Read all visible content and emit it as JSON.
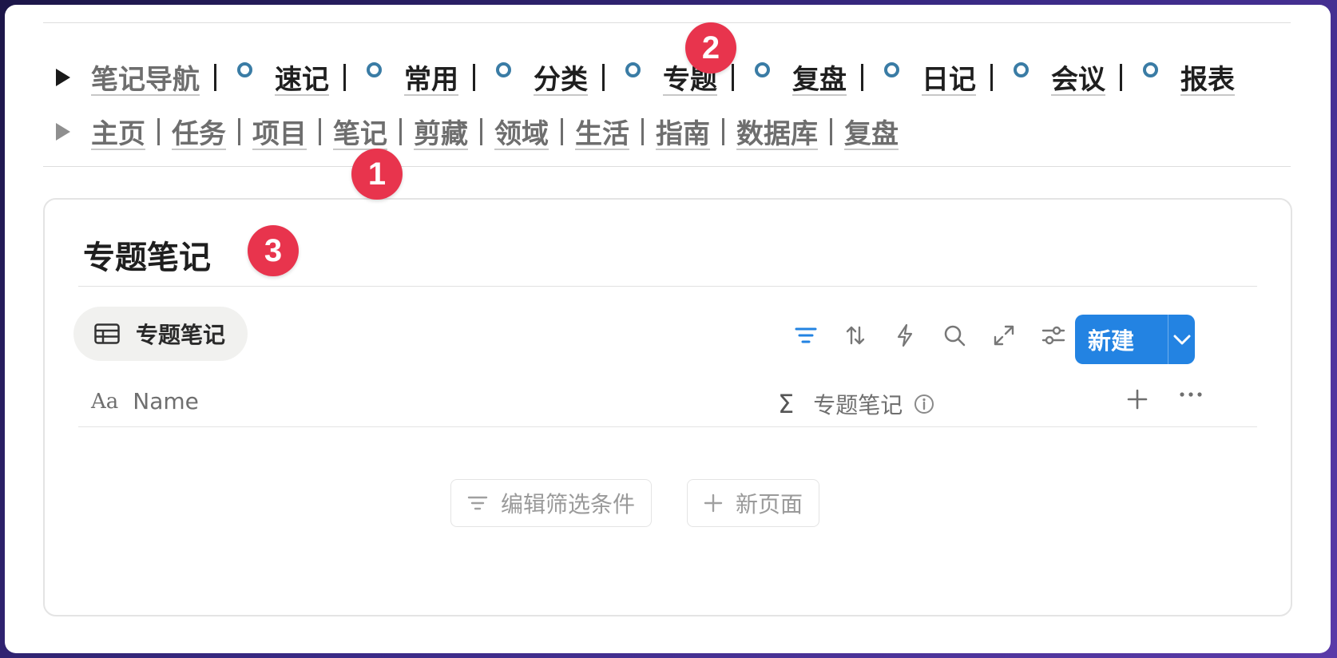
{
  "nav_primary": {
    "title": "笔记导航",
    "items": [
      "速记",
      "常用",
      "分类",
      "专题",
      "复盘",
      "日记",
      "会议",
      "报表"
    ]
  },
  "nav_secondary": {
    "items": [
      "主页",
      "任务",
      "项目",
      "笔记",
      "剪藏",
      "领域",
      "生活",
      "指南",
      "数据库",
      "复盘"
    ]
  },
  "badges": [
    "1",
    "2",
    "3"
  ],
  "panel": {
    "title": "专题笔记",
    "view_tab_label": "专题笔记",
    "new_button_label": "新建",
    "columns": {
      "name_prefix": "Aa",
      "name": "Name",
      "sum_symbol": "Σ",
      "rollup": "专题笔记"
    },
    "empty_actions": {
      "edit_filter": "编辑筛选条件",
      "new_page": "新页面"
    }
  },
  "colors": {
    "accent": "#2383e2",
    "badge": "#e8344d",
    "dot": "#3a7ca5"
  }
}
